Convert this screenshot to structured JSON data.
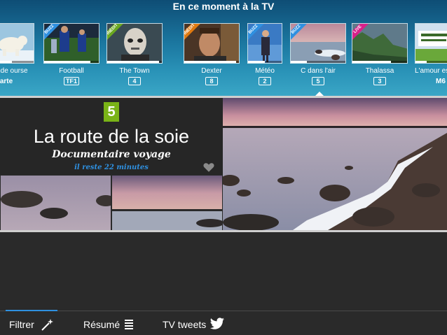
{
  "header": {
    "title": "En ce moment à la TV"
  },
  "channels": [
    {
      "name": "Grande ourse",
      "logo": "arte",
      "badge": "",
      "progress": 0.6
    },
    {
      "name": "Football",
      "logo": "TF1",
      "badge": "BUZZ",
      "badge_color": "#2f90e0",
      "progress": 0.85
    },
    {
      "name": "The Town",
      "logo": "4",
      "badge": "INÉDIT",
      "badge_color": "#6aa820",
      "progress": 0.95
    },
    {
      "name": "Dexter",
      "logo": "8",
      "badge": "INÉDIT",
      "badge_color": "#e07a10",
      "progress": 0.95
    },
    {
      "name": "Météo",
      "logo": "2",
      "badge": "BUZZ",
      "badge_color": "#2f90e0",
      "progress": 0.5
    },
    {
      "name": "C dans l'air",
      "logo": "5",
      "badge": "BUZZ",
      "badge_color": "#2f90e0",
      "progress": 0.3
    },
    {
      "name": "Thalassa",
      "logo": "3",
      "badge": "LIVE",
      "badge_color": "#d8208a",
      "progress": 0.7
    },
    {
      "name": "L'amour est dans le pré",
      "logo": "M6",
      "badge": "",
      "progress": 0.2
    }
  ],
  "program": {
    "channel_logo": "5",
    "title": "La route de la soie",
    "subtitle": "Documentaire voyage",
    "remaining": "il reste 22 minutes"
  },
  "tabs": [
    {
      "label": "Filtrer",
      "icon": "magic-wand-icon"
    },
    {
      "label": "Résumé",
      "icon": "list-lines-icon"
    },
    {
      "label": "TV tweets",
      "icon": "twitter-bird-icon"
    }
  ],
  "colors": {
    "accent": "#2f90e0",
    "channel5": "#7ab317",
    "header": "#1b77a0"
  }
}
